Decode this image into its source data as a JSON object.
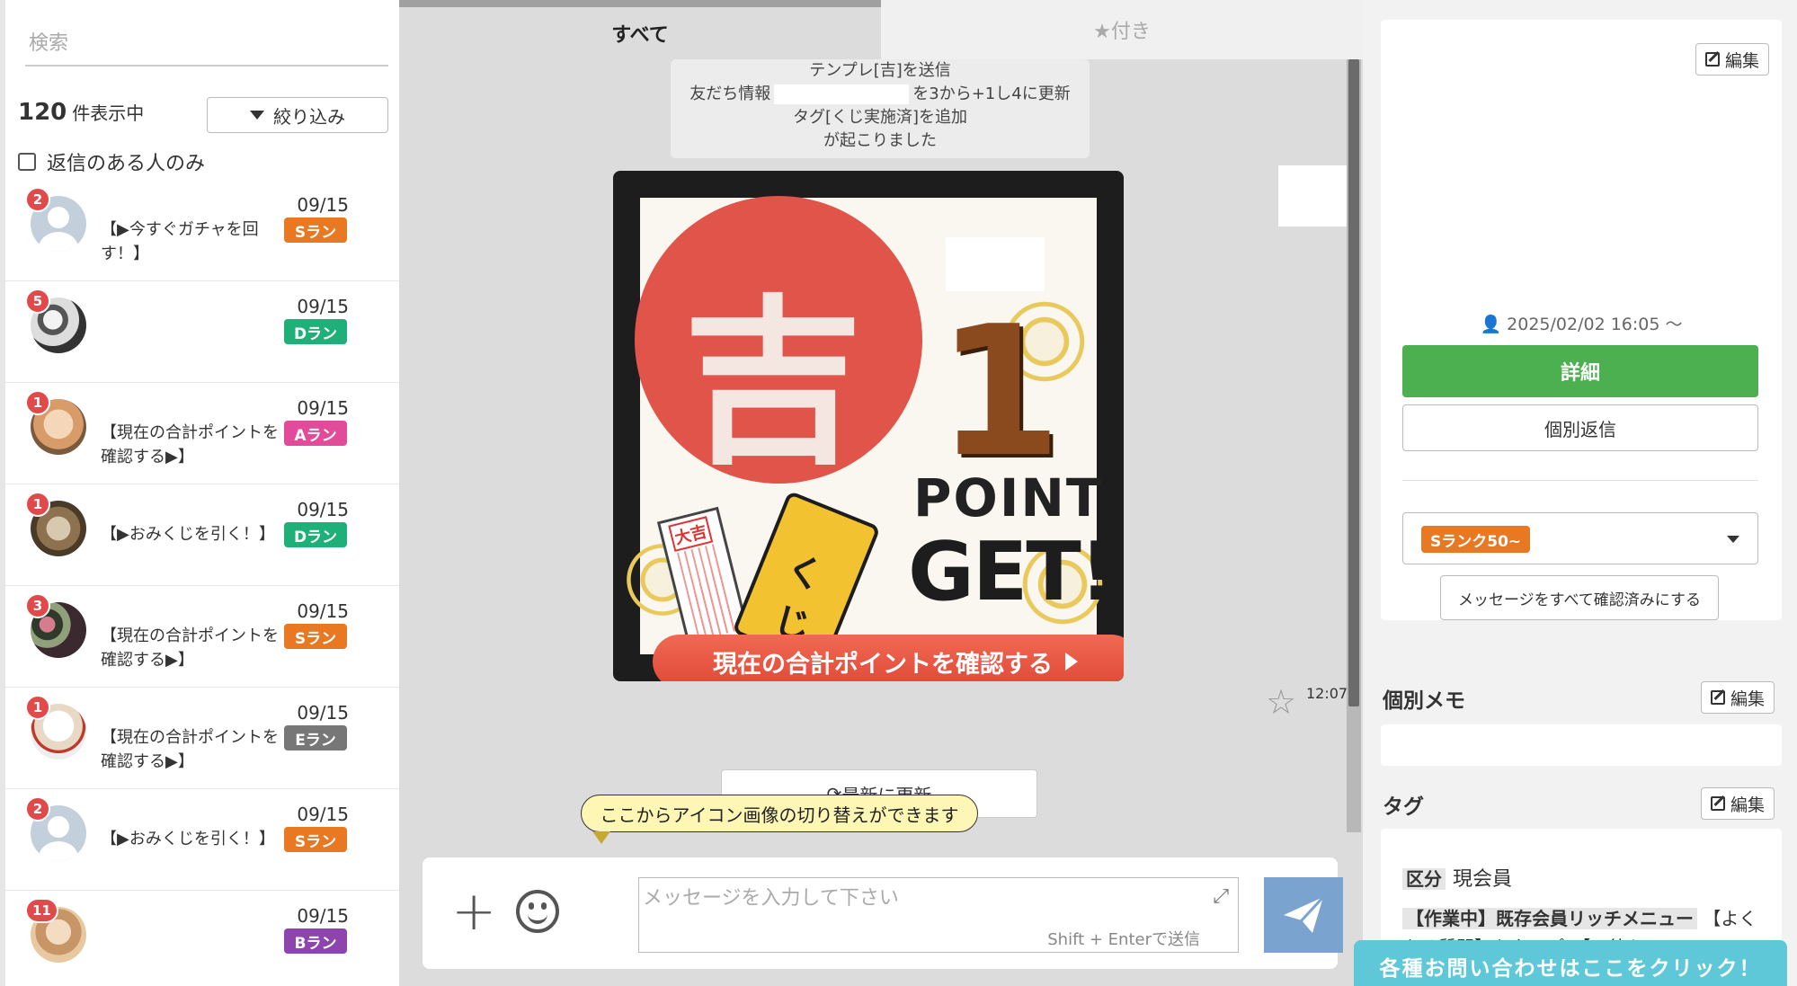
{
  "sidebar": {
    "search_placeholder": "検索",
    "count_number": "120",
    "count_suffix": "件表示中",
    "filter_label": "絞り込み",
    "reply_only_label": "返信のある人のみ",
    "friends": [
      {
        "unread": "2",
        "date": "09/15",
        "rank": "Sラン",
        "rank_color": "#e87822",
        "message": "【▶今すぐガチャを回す！】",
        "avatar": "av-default"
      },
      {
        "unread": "5",
        "date": "09/15",
        "rank": "Dラン",
        "rank_color": "#1fb07a",
        "message": "",
        "avatar": "av-photo1"
      },
      {
        "unread": "1",
        "date": "09/15",
        "rank": "Aラン",
        "rank_color": "#e24a9a",
        "message": "【現在の合計ポイントを確認する▶】",
        "avatar": "av-photo2"
      },
      {
        "unread": "1",
        "date": "09/15",
        "rank": "Dラン",
        "rank_color": "#1fb07a",
        "message": "【▶おみくじを引く！】",
        "avatar": "av-photo3"
      },
      {
        "unread": "3",
        "date": "09/15",
        "rank": "Sラン",
        "rank_color": "#e87822",
        "message": "【現在の合計ポイントを確認する▶】",
        "avatar": "av-photo4"
      },
      {
        "unread": "1",
        "date": "09/15",
        "rank": "Eラン",
        "rank_color": "#777777",
        "message": "【現在の合計ポイントを確認する▶】",
        "avatar": "av-photo5"
      },
      {
        "unread": "2",
        "date": "09/15",
        "rank": "Sラン",
        "rank_color": "#e87822",
        "message": "【▶おみくじを引く！】",
        "avatar": "av-default"
      },
      {
        "unread": "11",
        "date": "09/15",
        "rank": "Bラン",
        "rank_color": "#8e44ad",
        "message": "",
        "avatar": "av-photo6"
      }
    ]
  },
  "chat": {
    "tab_all": "すべて",
    "tab_starred": "★付き",
    "system_lines": {
      "line1": "テンプレ[吉]を送信",
      "line2_pre": "友だち情報",
      "line2_post": "を3から+1し4に更新",
      "line3": "タグ[くじ実施済]を追加",
      "line4": "が起こりました"
    },
    "stamp": {
      "seal_char": "吉",
      "number": "1",
      "point": "POINT",
      "get": "GET!",
      "kuji": "くじ",
      "paper": "大吉",
      "banner": "現在の合計ポイントを確認する"
    },
    "time": "12:07",
    "refresh_label": "最新に更新",
    "tooltip": "ここからアイコン画像の切り替えができます",
    "composer": {
      "placeholder": "メッセージを入力して下さい",
      "hint": "Shift + Enterで送信"
    }
  },
  "profile": {
    "edit_label": "編集",
    "since": "2025/02/02 16:05 〜",
    "detail_label": "詳細",
    "individual_reply_label": "個別返信",
    "rank_select": "Sランク50~",
    "mark_read_label": "メッセージをすべて確認済みにする",
    "memo_title": "個別メモ",
    "tag_title": "タグ",
    "tag_category_key": "区分",
    "tag_category_value": "現会員",
    "tag_line_key": "【作業中】既存会員リッチメニュー",
    "tag_line_rest": "【よくある質問】をタップ、【ス彼ト",
    "contact_label": "各種お問い合わせはここをクリック！"
  }
}
